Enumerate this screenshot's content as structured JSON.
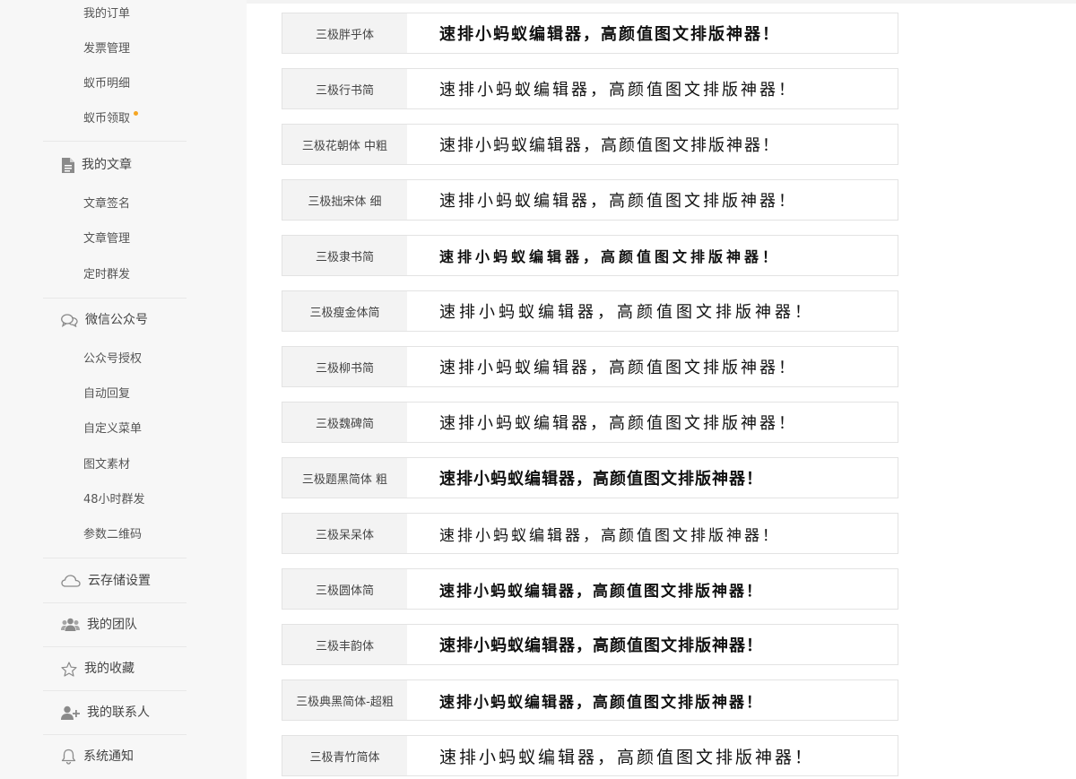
{
  "sidebar": {
    "orders": {
      "items": [
        "我的订单",
        "发票管理",
        "蚁币明细",
        "蚁币领取"
      ]
    },
    "articles": {
      "title": "我的文章",
      "icon": "document-icon",
      "items": [
        "文章签名",
        "文章管理",
        "定时群发"
      ]
    },
    "wechat": {
      "title": "微信公众号",
      "icon": "chat-bubbles-icon",
      "items": [
        "公众号授权",
        "自动回复",
        "自定义菜单",
        "图文素材",
        "48小时群发",
        "参数二维码"
      ]
    },
    "cloud": {
      "title": "云存储设置",
      "icon": "cloud-icon"
    },
    "team": {
      "title": "我的团队",
      "icon": "team-icon"
    },
    "favorites": {
      "title": "我的收藏",
      "icon": "star-icon"
    },
    "contacts": {
      "title": "我的联系人",
      "icon": "add-user-icon"
    },
    "notifications": {
      "title": "系统通知",
      "icon": "bell-icon"
    },
    "accent_dot_color": "#f5a623"
  },
  "fonts": {
    "sample_text": "速排小蚂蚁编辑器，高颜值图文排版神器！",
    "rows": [
      {
        "name": "三极胖乎体"
      },
      {
        "name": "三极行书简"
      },
      {
        "name": "三极花朝体 中粗"
      },
      {
        "name": "三极拙宋体 细"
      },
      {
        "name": "三极隶书简"
      },
      {
        "name": "三极瘦金体简"
      },
      {
        "name": "三极柳书简"
      },
      {
        "name": "三极魏碑简"
      },
      {
        "name": "三极题黑简体 粗"
      },
      {
        "name": "三极呆呆体"
      },
      {
        "name": "三极圆体简"
      },
      {
        "name": "三极丰韵体"
      },
      {
        "name": "三极典黑简体-超粗"
      },
      {
        "name": "三极青竹简体"
      }
    ]
  }
}
